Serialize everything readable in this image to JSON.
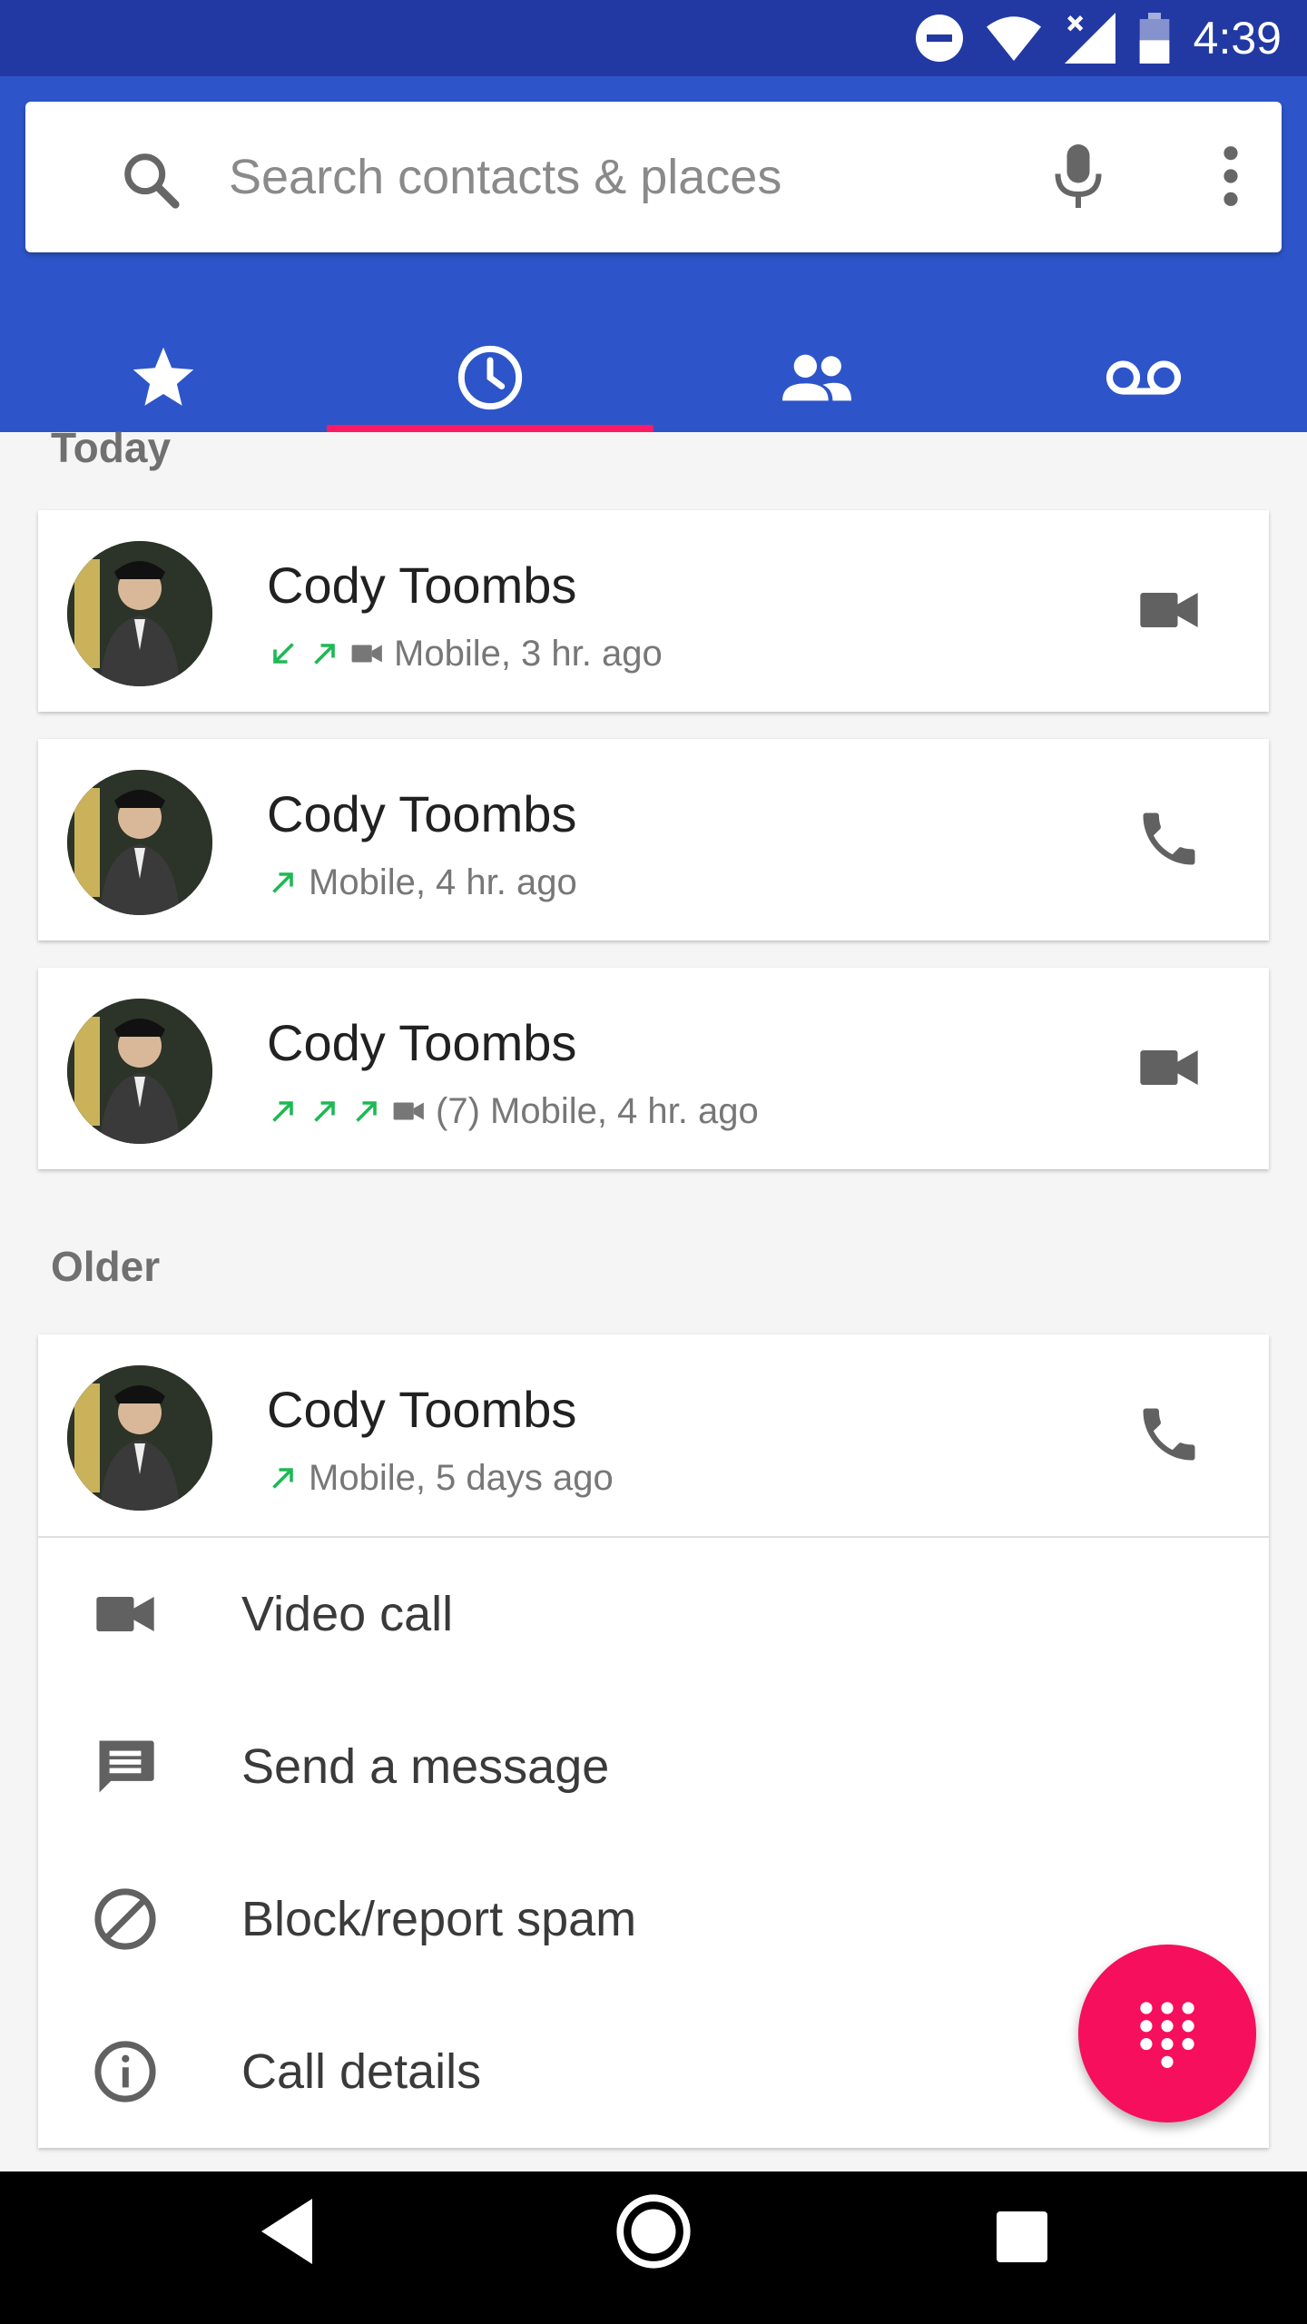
{
  "status_bar": {
    "time": "4:39"
  },
  "search": {
    "placeholder": "Search contacts & places"
  },
  "tabs": [
    {
      "name": "speed-dial",
      "icon": "star-icon"
    },
    {
      "name": "recents",
      "icon": "clock-icon",
      "active": true
    },
    {
      "name": "contacts",
      "icon": "people-icon"
    },
    {
      "name": "voicemail",
      "icon": "voicemail-icon"
    }
  ],
  "sections": {
    "today": "Today",
    "older": "Older"
  },
  "calls": [
    {
      "name": "Cody Toombs",
      "arrows": [
        "incoming",
        "outgoing"
      ],
      "video": true,
      "detail": "Mobile, 3 hr. ago",
      "action": "video-call"
    },
    {
      "name": "Cody Toombs",
      "arrows": [
        "outgoing"
      ],
      "video": false,
      "detail": "Mobile, 4 hr. ago",
      "action": "phone-call"
    },
    {
      "name": "Cody Toombs",
      "arrows": [
        "outgoing",
        "outgoing",
        "outgoing"
      ],
      "video": true,
      "detail": "(7) Mobile, 4 hr. ago",
      "action": "video-call"
    },
    {
      "name": "Cody Toombs",
      "arrows": [
        "outgoing"
      ],
      "video": false,
      "detail": "Mobile, 5 days ago",
      "action": "phone-call"
    }
  ],
  "expanded_menu": [
    {
      "label": "Video call",
      "icon": "videocam-icon"
    },
    {
      "label": "Send a message",
      "icon": "message-icon"
    },
    {
      "label": "Block/report spam",
      "icon": "block-icon"
    },
    {
      "label": "Call details",
      "icon": "info-icon"
    }
  ],
  "colors": {
    "status_bar": "#2239a4",
    "app_bar": "#2d55c9",
    "tab_indicator": "#ff1a66",
    "fab": "#f50f5c",
    "call_arrow": "#1db954"
  }
}
